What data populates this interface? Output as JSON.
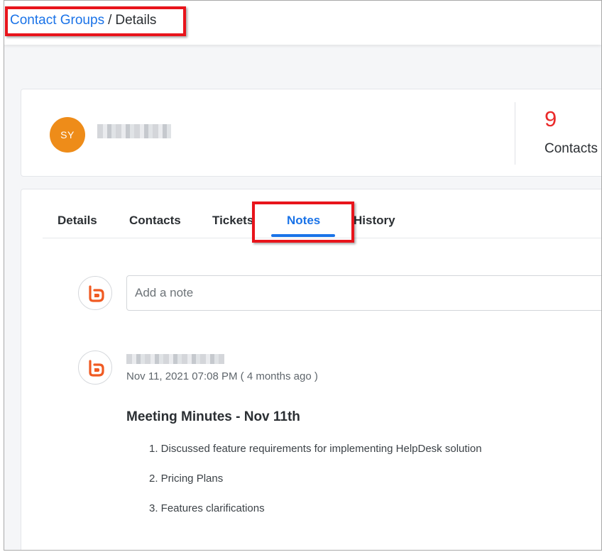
{
  "breadcrumb": {
    "parent": "Contact Groups",
    "separator": "/",
    "current": "Details"
  },
  "profile": {
    "avatar_initials": "SY",
    "avatar_color": "#ee8c19",
    "contacts_count": "9",
    "contacts_label": "Contacts",
    "count_color": "#ea2a2a"
  },
  "tabs": [
    {
      "label": "Details",
      "active": false
    },
    {
      "label": "Contacts",
      "active": false
    },
    {
      "label": "Tickets",
      "active": false
    },
    {
      "label": "Notes",
      "active": true
    },
    {
      "label": "History",
      "active": false
    }
  ],
  "notes": {
    "input_placeholder": "Add a note",
    "items": [
      {
        "timestamp": "Nov 11, 2021 07:08 PM ( 4 months ago )",
        "title": "Meeting Minutes - Nov 11th",
        "points": [
          "1. Discussed feature requirements for implementing HelpDesk solution",
          "2. Pricing Plans",
          "3. Features clarifications"
        ]
      }
    ]
  },
  "icons": {
    "brand_logo": "brand-logo-icon"
  },
  "colors": {
    "accent": "#1a73e8",
    "highlight": "#e8141b",
    "brand": "#f05a22"
  }
}
